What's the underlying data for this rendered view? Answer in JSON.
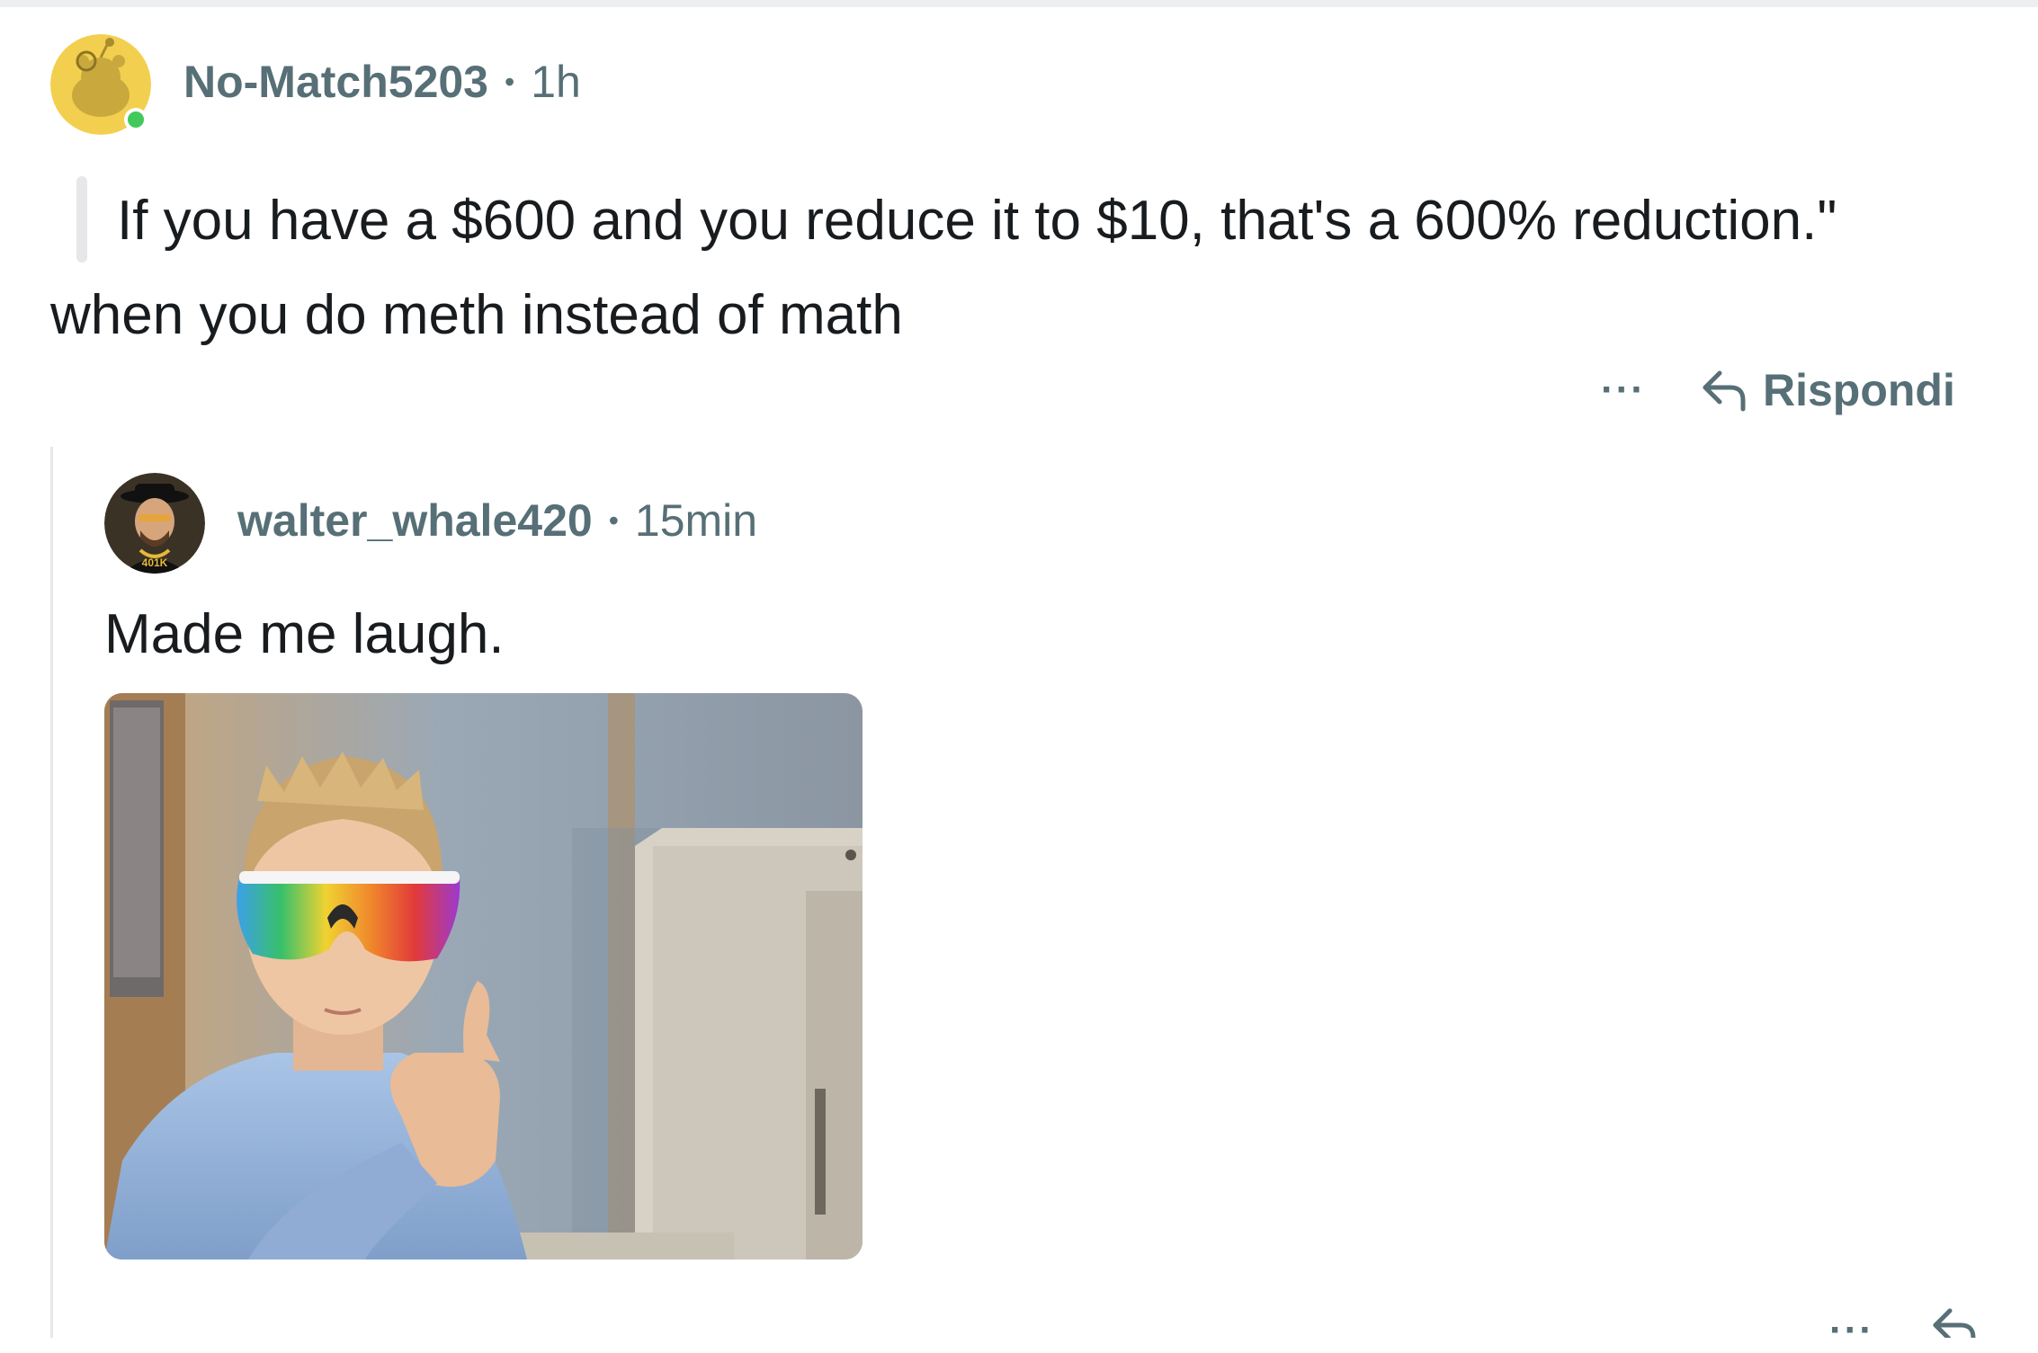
{
  "comment": {
    "username": "No-Match5203",
    "separator": "•",
    "time": "1h",
    "quote": "If you have a $600 and you reduce it to $10, that's a 600% reduction.\"",
    "body": "when you do meth instead of math",
    "more_label": "···",
    "reply_label": "Rispondi",
    "avatar_icon": "snoo-avatar-icon",
    "online_color": "#43c95b"
  },
  "reply": {
    "username": "walter_whale420",
    "separator": "•",
    "time": "15min",
    "body": "Made me laugh.",
    "more_label": "···",
    "avatar_icon": "heisenberg-avatar-icon",
    "avatar_text": "401K",
    "image_icon": "thumbs-up-kid-meme-image"
  },
  "colors": {
    "text": "#181c1f",
    "meta": "#576f76",
    "snoo_bg": "#f2cf4e"
  }
}
